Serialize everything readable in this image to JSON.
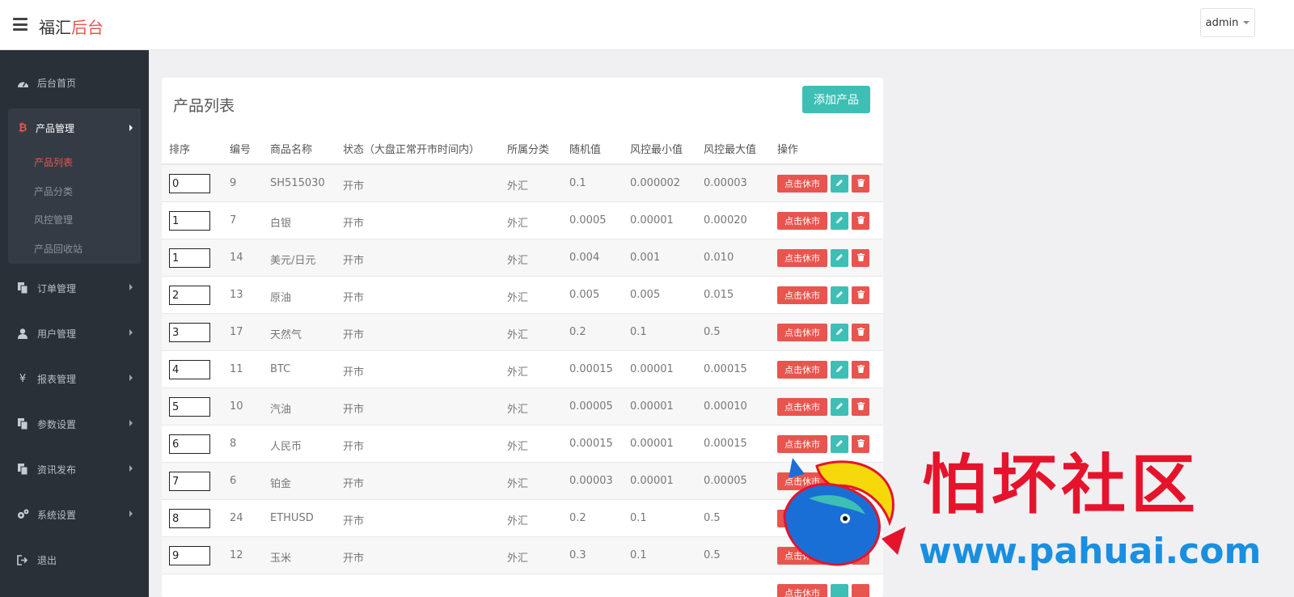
{
  "header": {
    "brand_main": "福汇",
    "brand_accent": "后台",
    "user": "admin"
  },
  "sidebar": {
    "dashboard": "后台首页",
    "product_mgmt": "产品管理",
    "sub_items": [
      "产品列表",
      "产品分类",
      "风控管理",
      "产品回收站"
    ],
    "order_mgmt": "订单管理",
    "user_mgmt": "用户管理",
    "report_mgmt": "报表管理",
    "param_settings": "参数设置",
    "news_publish": "资讯发布",
    "system_settings": "系统设置",
    "logout": "退出",
    "yen_symbol": "¥"
  },
  "panel": {
    "title": "产品列表",
    "add_button": "添加产品",
    "columns": [
      "排序",
      "编号",
      "商品名称",
      "状态（大盘正常开市时间内）",
      "所属分类",
      "随机值",
      "风控最小值",
      "风控最大值",
      "操作"
    ],
    "rest_button": "点击休市",
    "rows": [
      {
        "sort": "0",
        "id": "9",
        "name": "SH515030",
        "status": "开市",
        "category": "外汇",
        "random": "0.1",
        "min": "0.000002",
        "max": "0.00003"
      },
      {
        "sort": "1",
        "id": "7",
        "name": "白银",
        "status": "开市",
        "category": "外汇",
        "random": "0.0005",
        "min": "0.00001",
        "max": "0.00020"
      },
      {
        "sort": "1",
        "id": "14",
        "name": "美元/日元",
        "status": "开市",
        "category": "外汇",
        "random": "0.004",
        "min": "0.001",
        "max": "0.010"
      },
      {
        "sort": "2",
        "id": "13",
        "name": "原油",
        "status": "开市",
        "category": "外汇",
        "random": "0.005",
        "min": "0.005",
        "max": "0.015"
      },
      {
        "sort": "3",
        "id": "17",
        "name": "天然气",
        "status": "开市",
        "category": "外汇",
        "random": "0.2",
        "min": "0.1",
        "max": "0.5"
      },
      {
        "sort": "4",
        "id": "11",
        "name": "BTC",
        "status": "开市",
        "category": "外汇",
        "random": "0.00015",
        "min": "0.00001",
        "max": "0.00015"
      },
      {
        "sort": "5",
        "id": "10",
        "name": "汽油",
        "status": "开市",
        "category": "外汇",
        "random": "0.00005",
        "min": "0.00001",
        "max": "0.00010"
      },
      {
        "sort": "6",
        "id": "8",
        "name": "人民币",
        "status": "开市",
        "category": "外汇",
        "random": "0.00015",
        "min": "0.00001",
        "max": "0.00015"
      },
      {
        "sort": "7",
        "id": "6",
        "name": "铂金",
        "status": "开市",
        "category": "外汇",
        "random": "0.00003",
        "min": "0.00001",
        "max": "0.00005"
      },
      {
        "sort": "8",
        "id": "24",
        "name": "ETHUSD",
        "status": "开市",
        "category": "外汇",
        "random": "0.2",
        "min": "0.1",
        "max": "0.5"
      },
      {
        "sort": "9",
        "id": "12",
        "name": "玉米",
        "status": "开市",
        "category": "外汇",
        "random": "0.3",
        "min": "0.1",
        "max": "0.5"
      }
    ]
  },
  "watermark": {
    "title": "怕坏社区",
    "url": "www.pahuai.com"
  },
  "colors": {
    "accent_red": "#e8554e",
    "teal": "#3ebfb5",
    "sidebar_bg": "#2a3038"
  }
}
